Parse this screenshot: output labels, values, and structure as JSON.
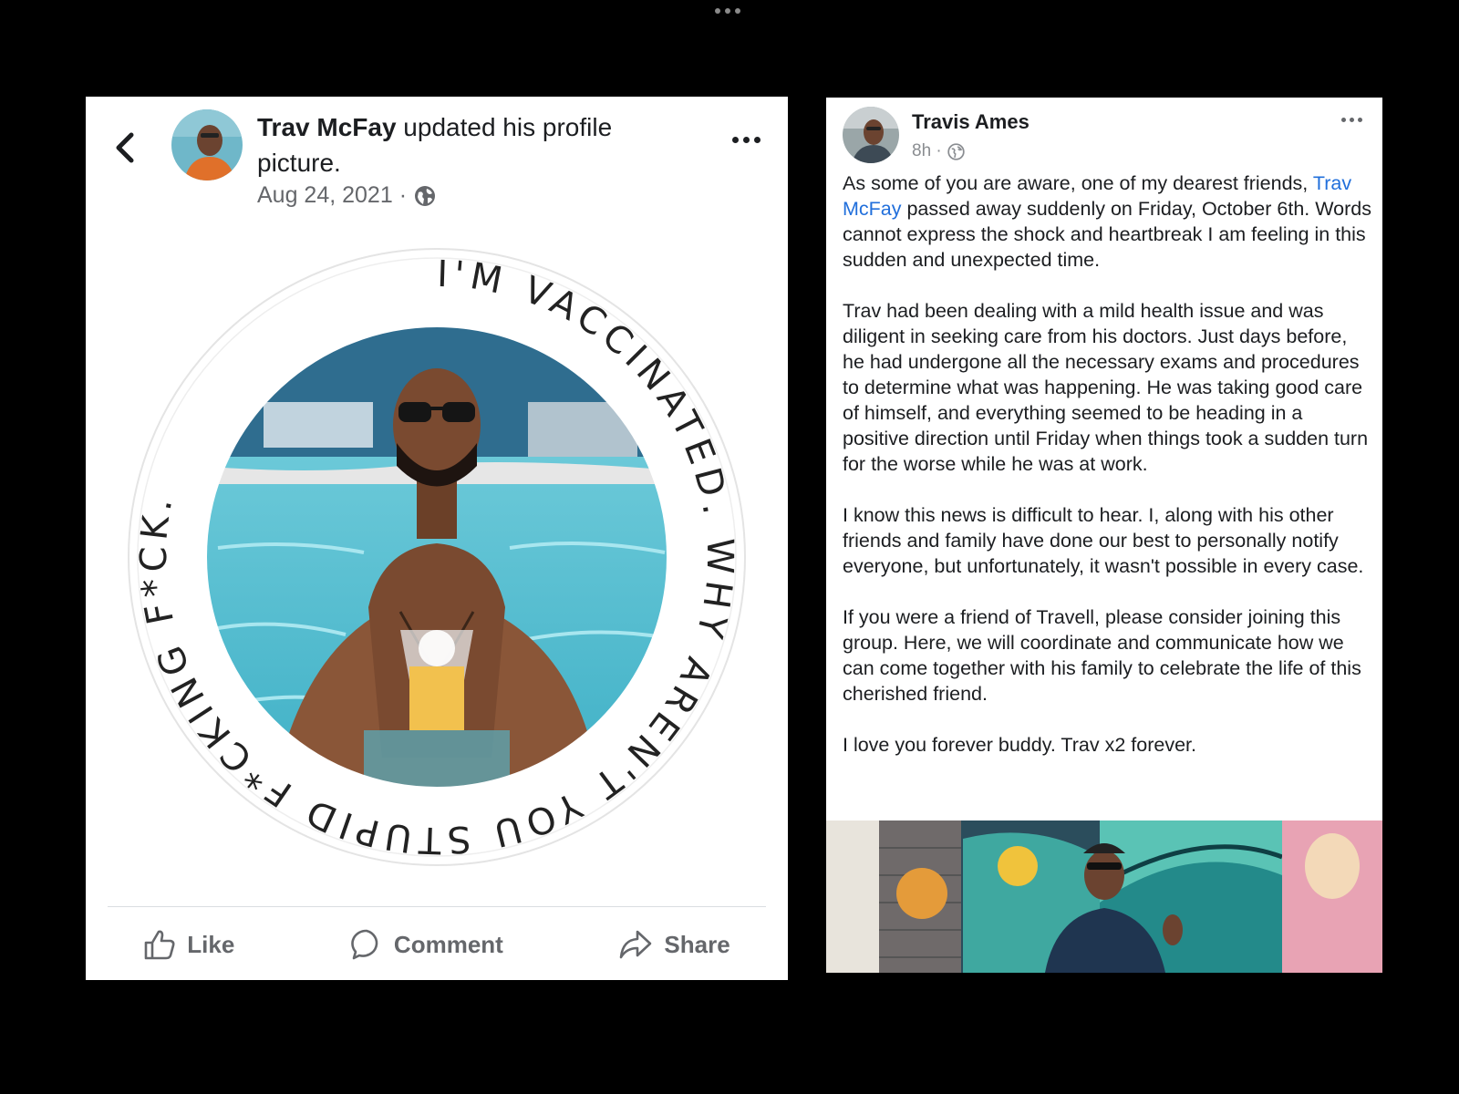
{
  "left_post": {
    "author": "Trav McFay",
    "action": " updated his profile picture.",
    "date": "Aug 24, 2021 ·",
    "ring_text": "I'M VACCINATED. WHY AREN'T YOU STUPID F*CKING F*CK. ",
    "actions": {
      "like": "Like",
      "comment": "Comment",
      "share": "Share"
    }
  },
  "right_post": {
    "author": "Travis Ames",
    "time": "8h ·",
    "mention": "Trav McFay",
    "para1_before": "As some of you are aware, one of my dearest friends, ",
    "para1_after": " passed away suddenly on Friday, October 6th. Words cannot express the shock and heartbreak I am feeling in this sudden and unexpected time.",
    "para2": "Trav had been dealing with a mild health issue and was diligent in seeking care from his doctors. Just days before, he had undergone all the necessary exams and procedures to determine what was happening. He was taking good care of himself, and everything seemed to be heading in a positive direction until Friday when things took a sudden turn for the worse while he was at work.",
    "para3": "I know this news is difficult to hear. I, along with his other friends and family have done our best to personally notify everyone, but unfortunately, it wasn't possible in every case.",
    "para4": "If you were a friend of Travell, please consider joining this group. Here, we will coordinate and communicate how we can come together with his family to celebrate the life of this cherished friend.",
    "para5": "I love you forever buddy. Trav x2 forever."
  },
  "colors": {
    "link": "#216fdb",
    "text": "#1c1e21",
    "muted": "#65676b",
    "pool": "#5cc4d6"
  },
  "icons": [
    "back-chevron-icon",
    "globe-icon",
    "more-options-icon",
    "like-thumb-icon",
    "comment-bubble-icon",
    "share-arrow-icon"
  ]
}
